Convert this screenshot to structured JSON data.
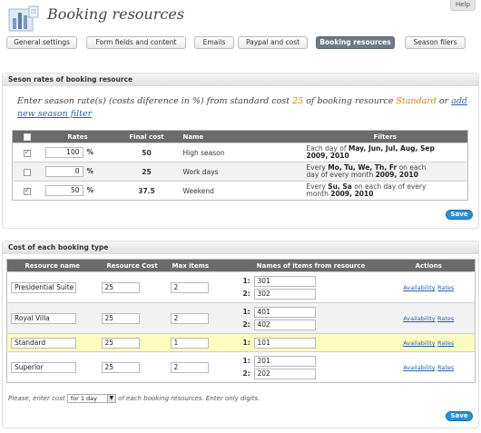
{
  "help": "Help",
  "title": "Booking resources",
  "tabs": [
    {
      "label": "General settings"
    },
    {
      "label": "Form fields and content"
    },
    {
      "label": "Emails"
    },
    {
      "label": "Paypal and cost"
    },
    {
      "label": "Booking resources",
      "active": true
    },
    {
      "label": "Season filers"
    }
  ],
  "season_panel": {
    "heading": "Seson rates of booking resource",
    "intro_before": "Enter season rate(s) (costs diference in %) from standard cost ",
    "intro_cost": "25",
    "intro_middle": " of booking resource ",
    "intro_resource": "Standard",
    "intro_or": " or ",
    "intro_link": "add new season filter",
    "columns": [
      "Rates",
      "Final cost",
      "Name",
      "Filters"
    ],
    "rows": [
      {
        "checked": true,
        "rate": "100",
        "pct": "%",
        "final": "50",
        "name": "High season",
        "f1": "Each day of ",
        "f1b": "May, Jun, Jul, Aug, Sep",
        "f2": "",
        "f2b": "2009, 2010"
      },
      {
        "checked": false,
        "rate": "0",
        "pct": "%",
        "final": "25",
        "name": "Work days",
        "f1": "Every ",
        "f1b": "Mo, Tu, We, Th, Fr",
        "f1c": " on each",
        "f2": "day of every month ",
        "f2b": "2009, 2010"
      },
      {
        "checked": true,
        "rate": "50",
        "pct": "%",
        "final": "37.5",
        "name": "Weekend",
        "f1": "Every ",
        "f1b": "Su, Sa",
        "f1c": " on each day of every",
        "f2": "month ",
        "f2b": "2009, 2010"
      }
    ],
    "save": "Save"
  },
  "cost_panel": {
    "heading": "Cost of each booking type",
    "columns": [
      "Resource name",
      "Resource Cost",
      "Max items",
      "Names of items from resource",
      "Actions"
    ],
    "rows": [
      {
        "name": "Presidential Suite",
        "cost": "25",
        "max": "2",
        "items": [
          {
            "n": "1:",
            "v": "301"
          },
          {
            "n": "2:",
            "v": "302"
          }
        ]
      },
      {
        "name": "Royal Villa",
        "cost": "25",
        "max": "2",
        "items": [
          {
            "n": "1:",
            "v": "401"
          },
          {
            "n": "2:",
            "v": "402"
          }
        ]
      },
      {
        "name": "Standard",
        "cost": "25",
        "max": "1",
        "items": [
          {
            "n": "1:",
            "v": "101"
          }
        ]
      },
      {
        "name": "Superior",
        "cost": "25",
        "max": "2",
        "items": [
          {
            "n": "1:",
            "v": "201"
          },
          {
            "n": "2:",
            "v": "202"
          }
        ]
      }
    ],
    "action_availability": "Availability",
    "action_rates": "Rates",
    "note_before": "Please, enter cost",
    "period": "for 1 day",
    "note_after": "of each booking resources. Enter only digits.",
    "save": "Save"
  },
  "colors": {
    "accent": "#d98500",
    "button": "#2a8fd0",
    "highlight_row": "#fcfbc0",
    "header": "#6b6b6b"
  }
}
